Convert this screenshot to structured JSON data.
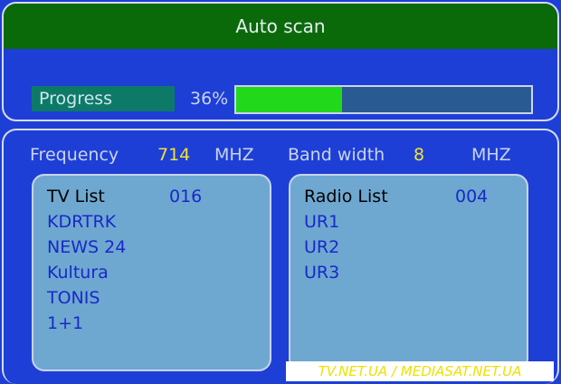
{
  "title": "Auto scan",
  "progress": {
    "label": "Progress",
    "percent_text": "36%",
    "value": 0.36
  },
  "frequency": {
    "label": "Frequency",
    "value": "714",
    "unit": "MHZ"
  },
  "bandwidth": {
    "label": "Band width",
    "value": "8",
    "unit": "MHZ"
  },
  "tv_list": {
    "header": "TV List",
    "count": "016",
    "channels": [
      "KDRTRK",
      "NEWS 24",
      "Kultura",
      "TONIS",
      "1+1"
    ]
  },
  "radio_list": {
    "header": "Radio List",
    "count": "004",
    "channels": [
      "UR1",
      "UR2",
      "UR3"
    ]
  },
  "watermark": "TV.NET.UA / MEDIASAT.NET.UA",
  "colors": {
    "title_bar": "#0a6a0a",
    "background": "#1e3fd6",
    "progress_fill": "#22d81a",
    "list_box": "#6ea8d0",
    "highlight_value": "#f0e23a"
  }
}
